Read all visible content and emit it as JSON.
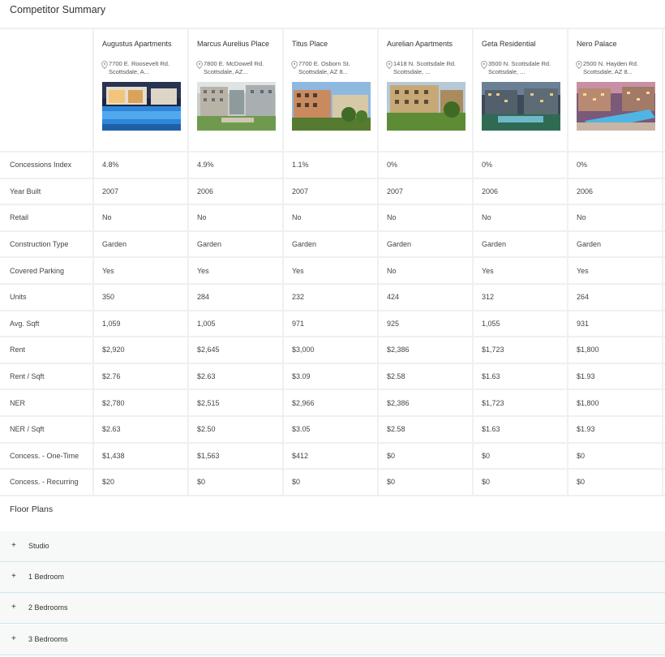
{
  "header": {
    "title": "Competitor Summary"
  },
  "properties": [
    {
      "name": "Augustus Apartments",
      "address": "7700 E. Roosevelt Rd. Scottsdale, A..."
    },
    {
      "name": "Marcus Aurelius Place",
      "address": "7800 E. McDowell Rd. Scottsdale, AZ..."
    },
    {
      "name": "Titus Place",
      "address": "7700 E. Osborn St. Scottsdale, AZ 8..."
    },
    {
      "name": "Aurelian Apartments",
      "address": "1418 N. Scottsdale Rd. Scottsdale, ..."
    },
    {
      "name": "Geta Residential",
      "address": "3500 N. Scottsdale Rd. Scottsdale, ..."
    },
    {
      "name": "Nero Palace",
      "address": "2500 N. Hayden Rd. Scottsdale, AZ 8..."
    }
  ],
  "rows": [
    {
      "label": "Concessions Index",
      "values": [
        "4.8%",
        "4.9%",
        "1.1%",
        "0%",
        "0%",
        "0%"
      ]
    },
    {
      "label": "Year Built",
      "values": [
        "2007",
        "2006",
        "2007",
        "2007",
        "2006",
        "2006"
      ]
    },
    {
      "label": "Retail",
      "values": [
        "No",
        "No",
        "No",
        "No",
        "No",
        "No"
      ]
    },
    {
      "label": "Construction Type",
      "values": [
        "Garden",
        "Garden",
        "Garden",
        "Garden",
        "Garden",
        "Garden"
      ]
    },
    {
      "label": "Covered Parking",
      "values": [
        "Yes",
        "Yes",
        "Yes",
        "No",
        "Yes",
        "Yes"
      ]
    },
    {
      "label": "Units",
      "values": [
        "350",
        "284",
        "232",
        "424",
        "312",
        "264"
      ]
    },
    {
      "label": "Avg. Sqft",
      "values": [
        "1,059",
        "1,005",
        "971",
        "925",
        "1,055",
        "931"
      ]
    },
    {
      "label": "Rent",
      "values": [
        "$2,920",
        "$2,645",
        "$3,000",
        "$2,386",
        "$1,723",
        "$1,800"
      ]
    },
    {
      "label": "Rent / Sqft",
      "values": [
        "$2.76",
        "$2.63",
        "$3.09",
        "$2.58",
        "$1.63",
        "$1.93"
      ]
    },
    {
      "label": "NER",
      "values": [
        "$2,780",
        "$2,515",
        "$2,966",
        "$2,386",
        "$1,723",
        "$1,800"
      ]
    },
    {
      "label": "NER / Sqft",
      "values": [
        "$2.63",
        "$2.50",
        "$3.05",
        "$2.58",
        "$1.63",
        "$1.93"
      ]
    },
    {
      "label": "Concess. - One-Time",
      "values": [
        "$1,438",
        "$1,563",
        "$412",
        "$0",
        "$0",
        "$0"
      ]
    },
    {
      "label": "Concess. - Recurring",
      "values": [
        "$20",
        "$0",
        "$0",
        "$0",
        "$0",
        "$0"
      ]
    }
  ],
  "floor_plans": {
    "title": "Floor Plans",
    "items": [
      "Studio",
      "1 Bedroom",
      "2 Bedrooms",
      "3 Bedrooms"
    ]
  },
  "icons": {
    "location": "map-pin-icon",
    "expand": "plus-icon"
  },
  "colors": {
    "border": "#eef0f2",
    "accordion_bg": "#f7f8f8",
    "accordion_divider": "#cde6ef",
    "pin": "#9aa6b2"
  }
}
